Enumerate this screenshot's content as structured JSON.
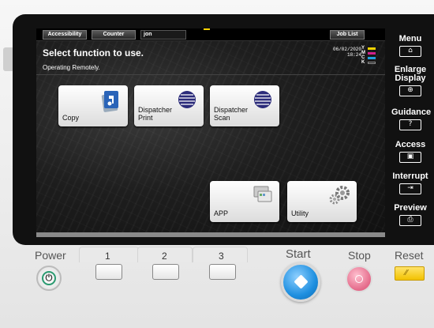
{
  "status_bar": {
    "accessibility": "Accessibility",
    "counter": "Counter",
    "user": "jon",
    "job_list": "Job List"
  },
  "header": {
    "title": "Select function to use.",
    "subtitle": "Operating Remotely.",
    "date": "06/02/2020",
    "time": "18:24"
  },
  "toner": [
    {
      "label": "Y",
      "color": "#f2d200"
    },
    {
      "label": "M",
      "color": "#d0208a"
    },
    {
      "label": "C",
      "color": "#20a0e0"
    },
    {
      "label": "K",
      "color": "#222222"
    }
  ],
  "tiles": {
    "copy": "Copy",
    "dispatcher_print": "Dispatcher\nPrint",
    "dispatcher_scan": "Dispatcher\nScan",
    "app": "APP",
    "utility": "Utility"
  },
  "side_panel": {
    "menu": "Menu",
    "enlarge_display": "Enlarge\nDisplay",
    "guidance": "Guidance",
    "guidance_key": "?",
    "access": "Access",
    "interrupt": "Interrupt",
    "preview": "Preview"
  },
  "bottom_panel": {
    "power": "Power",
    "key1": "1",
    "key2": "2",
    "key3": "3",
    "start": "Start",
    "stop": "Stop",
    "reset": "Reset"
  },
  "colors": {
    "start": "#1e8fe0",
    "stop": "#e46a8a",
    "reset": "#f2c200",
    "power_ring": "#2a9a70"
  }
}
